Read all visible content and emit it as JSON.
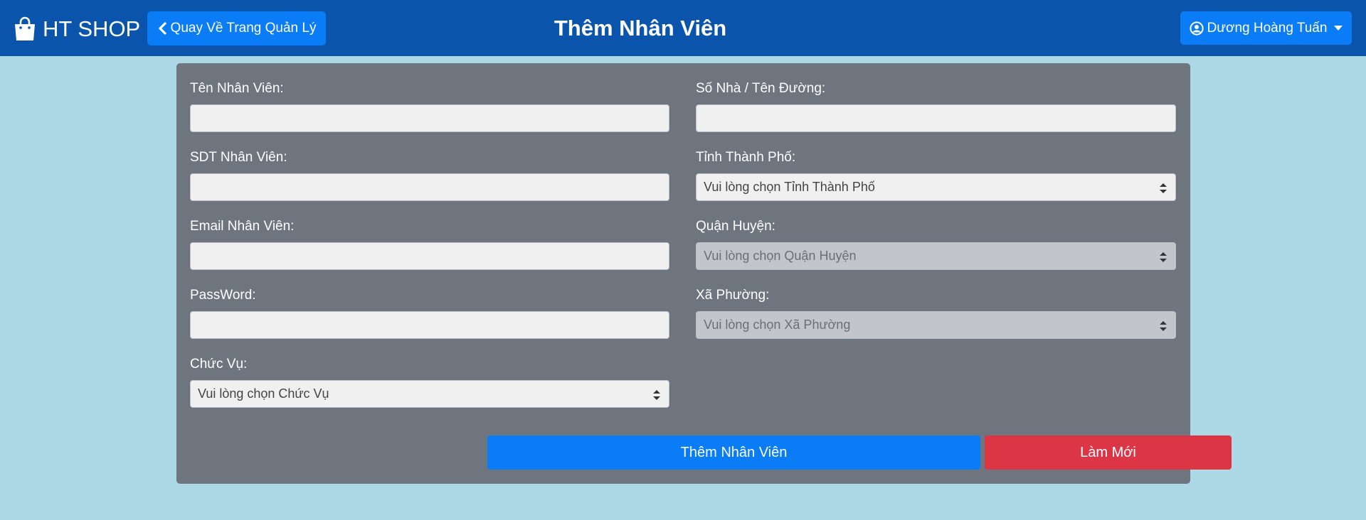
{
  "header": {
    "brand": "HT SHOP",
    "back_label": "Quay Về Trang Quản Lý",
    "title": "Thêm Nhân Viên",
    "user_name": "Dương Hoàng Tuấn"
  },
  "form": {
    "ten_label": "Tên Nhân Viên:",
    "ten_value": "",
    "sdt_label": "SDT Nhân Viên:",
    "sdt_value": "",
    "email_label": "Email Nhân Viên:",
    "email_value": "",
    "password_label": "PassWord:",
    "password_value": "",
    "chucvu_label": "Chức Vụ:",
    "chucvu_selected": "Vui lòng chọn Chức Vụ",
    "sonha_label": "Số Nhà / Tên Đường:",
    "sonha_value": "",
    "tinh_label": "Tỉnh Thành Phố:",
    "tinh_selected": "Vui lòng chọn Tỉnh Thành Phố",
    "quan_label": "Quận Huyện:",
    "quan_selected": "Vui lòng chọn Quận Huyện",
    "xa_label": "Xã Phường:",
    "xa_selected": "Vui lòng chọn Xã Phường"
  },
  "actions": {
    "submit_label": "Thêm Nhân Viên",
    "reset_label": "Làm Mới"
  },
  "colors": {
    "navbar": "#0a55ab",
    "primary": "#0a7cf5",
    "danger": "#dc3546",
    "panel": "#6e757f",
    "background": "#add8e6"
  }
}
